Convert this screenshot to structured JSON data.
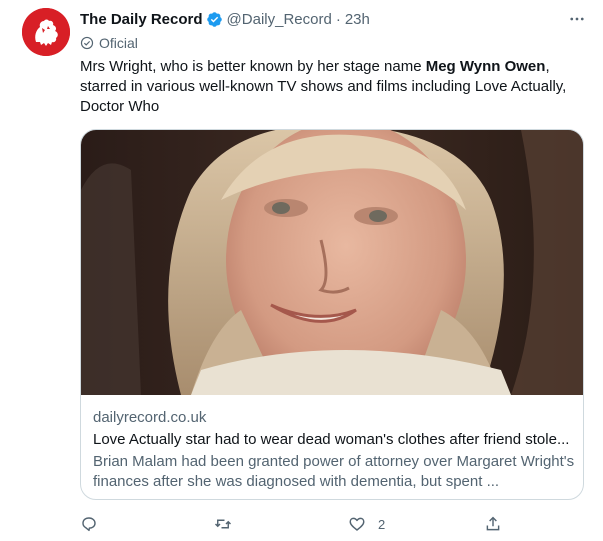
{
  "tweet": {
    "author_name": "The Daily Record",
    "handle": "@Daily_Record",
    "separator": "·",
    "time": "23h",
    "label": "Oficial",
    "text_before": "Mrs Wright, who is better known by her stage name ",
    "text_bold": "Meg Wynn Owen",
    "text_after": ", starred in various well-known TV shows and films including Love Actually, Doctor Who",
    "more_icon": "more-icon"
  },
  "card": {
    "domain": "dailyrecord.co.uk",
    "title": "Love Actually star had to wear dead woman's clothes after friend stole...",
    "description": "Brian Malam had been granted power of attorney over Margaret Wright's finances after she was diagnosed with dementia, but spent ..."
  },
  "actions": {
    "reply_icon": "reply-icon",
    "retweet_icon": "retweet-icon",
    "like_icon": "like-icon",
    "like_count": "2",
    "share_icon": "share-icon"
  },
  "colors": {
    "brand_red": "#d81f26",
    "verified_blue": "#1d9bf0",
    "secondary_text": "#536471"
  }
}
